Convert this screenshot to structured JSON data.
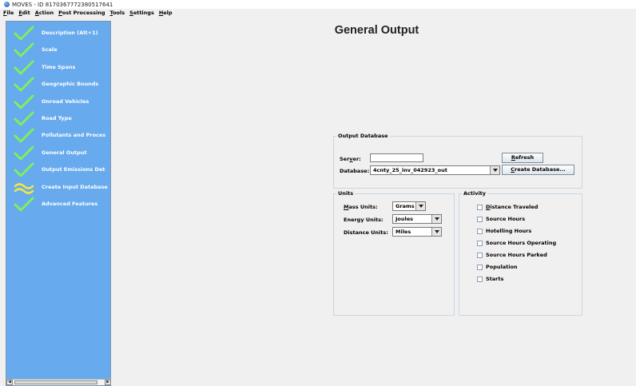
{
  "window": {
    "title": "MOVES - ID 8170367772380517641",
    "icon": "moves-globe-icon"
  },
  "menu": [
    {
      "id": "file",
      "mnemonic": "F",
      "rest": "ile"
    },
    {
      "id": "edit",
      "mnemonic": "E",
      "rest": "dit"
    },
    {
      "id": "action",
      "mnemonic": "A",
      "rest": "ction"
    },
    {
      "id": "post-processing",
      "mnemonic": "P",
      "rest": "ost Processing"
    },
    {
      "id": "tools",
      "mnemonic": "T",
      "rest": "ools"
    },
    {
      "id": "settings",
      "mnemonic": "S",
      "rest": "ettings"
    },
    {
      "id": "help",
      "mnemonic": "H",
      "rest": "elp"
    }
  ],
  "sidebar": {
    "items": [
      {
        "label": "Description (Alt+1)",
        "status": "complete",
        "icon": "checkmark-icon"
      },
      {
        "label": "Scale",
        "status": "complete",
        "icon": "checkmark-icon"
      },
      {
        "label": "Time Spans",
        "status": "complete",
        "icon": "checkmark-icon"
      },
      {
        "label": "Geographic Bounds",
        "status": "complete",
        "icon": "checkmark-icon"
      },
      {
        "label": "Onroad Vehicles",
        "status": "complete",
        "icon": "checkmark-icon"
      },
      {
        "label": "Road Type",
        "status": "complete",
        "icon": "checkmark-icon"
      },
      {
        "label": "Pollutants and Proces",
        "status": "complete",
        "icon": "checkmark-icon"
      },
      {
        "label": "General Output",
        "status": "complete",
        "icon": "checkmark-icon"
      },
      {
        "label": "Output Emissions Det",
        "status": "complete",
        "icon": "checkmark-icon"
      },
      {
        "label": "Create Input Database",
        "status": "optional",
        "icon": "approx-wave-icon"
      },
      {
        "label": "Advanced Features",
        "status": "complete",
        "icon": "checkmark-icon"
      }
    ],
    "colors": {
      "background": "#67aaee",
      "check": "#7ef05a",
      "wave": "#f2e542"
    }
  },
  "main": {
    "title": "General Output",
    "output_database": {
      "group_label": "Output Database",
      "server_label_pre": "Ser",
      "server_mnemonic": "v",
      "server_label_post": "er:",
      "server_value": "",
      "database_label": "Database:",
      "database_value": "4cnty_25_inv_042923_out",
      "refresh_pre": "",
      "refresh_mnemonic": "R",
      "refresh_post": "efresh",
      "create_pre": "",
      "create_mnemonic": "C",
      "create_post": "reate Database..."
    },
    "units": {
      "group_label": "Units",
      "mass_mnemonic": "M",
      "mass_rest": "ass Units:",
      "mass_value": "Grams",
      "energy_label": "Energy Units:",
      "energy_value": "Joules",
      "distance_label": "Distance Units:",
      "distance_value": "Miles"
    },
    "activity": {
      "group_label": "Activity",
      "items": [
        {
          "mnemonic": "D",
          "rest": "istance Traveled",
          "checked": false
        },
        {
          "mnemonic": "",
          "rest": "Source Hours",
          "checked": false
        },
        {
          "mnemonic": "",
          "rest": "Hotelling Hours",
          "checked": false
        },
        {
          "mnemonic": "",
          "rest": "Source Hours Operating",
          "checked": false
        },
        {
          "mnemonic": "",
          "rest": "Source Hours Parked",
          "checked": false
        },
        {
          "mnemonic": "",
          "rest": "Population",
          "checked": false
        },
        {
          "mnemonic": "",
          "rest": "Starts",
          "checked": false
        }
      ]
    }
  }
}
